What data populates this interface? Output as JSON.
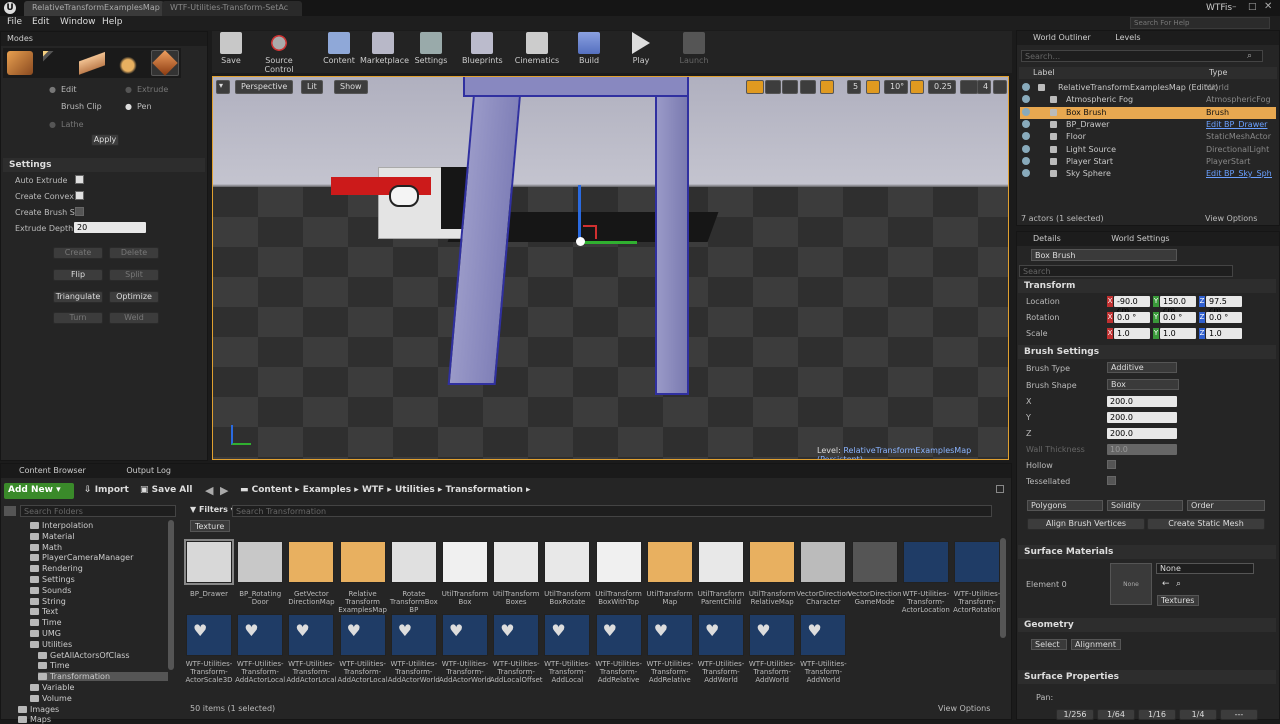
{
  "tabs": [
    {
      "label": "RelativeTransformExamplesMap"
    },
    {
      "label": "WTF-Utilities-Transform-SetAc"
    }
  ],
  "window_title": "WTFis",
  "search_help_placeholder": "Search For Help",
  "menu": [
    "File",
    "Edit",
    "Window",
    "Help"
  ],
  "modes": {
    "panel_label": "Modes",
    "edit": "Edit",
    "extrude": "Extrude",
    "brush_clip": "Brush Clip",
    "pen": "Pen",
    "lathe": "Lathe",
    "apply": "Apply",
    "settings_header": "Settings",
    "auto_extrude": "Auto Extrude",
    "create_convex": "Create Convex P",
    "create_brush": "Create Brush Sh",
    "extrude_depth": "Extrude Depth",
    "extrude_depth_value": "20",
    "buttons": {
      "create": "Create",
      "delete": "Delete",
      "flip": "Flip",
      "split": "Split",
      "triangulate": "Triangulate",
      "optimize": "Optimize",
      "turn": "Turn",
      "weld": "Weld"
    }
  },
  "toolbar": [
    {
      "label": "Save",
      "icon": "save-icon"
    },
    {
      "label": "Source Control",
      "icon": "source-control-icon"
    },
    {
      "label": "Content",
      "icon": "content-icon"
    },
    {
      "label": "Marketplace",
      "icon": "marketplace-icon"
    },
    {
      "label": "Settings",
      "icon": "settings-icon"
    },
    {
      "label": "Blueprints",
      "icon": "blueprints-icon"
    },
    {
      "label": "Cinematics",
      "icon": "cinematics-icon"
    },
    {
      "label": "Build",
      "icon": "build-icon"
    },
    {
      "label": "Play",
      "icon": "play-icon"
    },
    {
      "label": "Launch",
      "icon": "launch-icon"
    }
  ],
  "viewport": {
    "perspective": "Perspective",
    "lit": "Lit",
    "show": "Show",
    "grid_snap": "5",
    "rotation_snap": "10°",
    "scale_snap": "0.25",
    "camera_speed": "4",
    "level_label": "Level:",
    "level_name": "RelativeTransformExamplesMap (Persistent)"
  },
  "outliner": {
    "tab": "World Outliner",
    "levels_tab": "Levels",
    "search_placeholder": "Search...",
    "col_label": "Label",
    "col_type": "Type",
    "rows": [
      {
        "label": "RelativeTransformExamplesMap (Editor)",
        "type": "World"
      },
      {
        "label": "Atmospheric Fog",
        "type": "AtmosphericFog"
      },
      {
        "label": "Box Brush",
        "type": "Brush"
      },
      {
        "label": "BP_Drawer",
        "type": "Edit BP_Drawer"
      },
      {
        "label": "Floor",
        "type": "StaticMeshActor"
      },
      {
        "label": "Light Source",
        "type": "DirectionalLight"
      },
      {
        "label": "Player Start",
        "type": "PlayerStart"
      },
      {
        "label": "Sky Sphere",
        "type": "Edit BP_Sky_Sphe"
      }
    ],
    "status": "7 actors (1 selected)",
    "view_options": "View Options"
  },
  "details": {
    "tab": "Details",
    "world_settings_tab": "World Settings",
    "selected_name": "Box Brush",
    "search_placeholder": "Search",
    "transform_header": "Transform",
    "location_label": "Location",
    "rotation_label": "Rotation",
    "scale_label": "Scale",
    "location": [
      "-90.0 cm",
      "150.0 cm",
      "97.5 cm"
    ],
    "rotation": [
      "0.0 °",
      "0.0 °",
      "0.0 °"
    ],
    "scale": [
      "1.0",
      "1.0",
      "1.0"
    ],
    "axis_x": "X",
    "axis_y": "Y",
    "axis_z": "Z",
    "brush_settings_header": "Brush Settings",
    "brush_type_label": "Brush Type",
    "brush_type_value": "Additive",
    "brush_shape_label": "Brush Shape",
    "brush_shape_value": "Box",
    "x_label": "X",
    "y_label": "Y",
    "z_label": "Z",
    "x_value": "200.0",
    "y_value": "200.0",
    "z_value": "200.0",
    "wall_thickness_label": "Wall Thickness",
    "wall_thickness_value": "10.0",
    "hollow_label": "Hollow",
    "tessellated_label": "Tessellated",
    "polygons": "Polygons",
    "solidity": "Solidity",
    "order": "Order",
    "align_brush": "Align Brush Vertices",
    "create_static_mesh": "Create Static Mesh",
    "surface_materials_header": "Surface Materials",
    "element0": "Element 0",
    "none_thumb": "None",
    "none_select": "None",
    "textures": "Textures",
    "geometry_header": "Geometry",
    "select": "Select",
    "alignment": "Alignment",
    "surface_props_header": "Surface Properties",
    "pan_label": "Pan:",
    "pan_values": [
      "1/256",
      "1/64",
      "1/16",
      "1/4",
      "---"
    ]
  },
  "content_browser": {
    "tab": "Content Browser",
    "output_tab": "Output Log",
    "add_new": "Add New",
    "import": "Import",
    "save_all": "Save All",
    "breadcrumb": [
      "Content",
      "Examples",
      "WTF",
      "Utilities",
      "Transformation"
    ],
    "search_folders_placeholder": "Search Folders",
    "filters": "Filters",
    "search_placeholder": "Search Transformation",
    "filter_chip": "Texture",
    "folders": [
      "Interpolation",
      "Material",
      "Math",
      "PlayerCameraManager",
      "Rendering",
      "Settings",
      "Sounds",
      "String",
      "Text",
      "Time",
      "UMG",
      "Utilities",
      "GetAllActorsOfClass",
      "Time",
      "Transformation",
      "Variable",
      "Volume",
      "Images",
      "Maps"
    ],
    "assets_row1": [
      "BP_Drawer",
      "BP_Rotating Door",
      "GetVector DirectionMap",
      "Relative Transform ExamplesMap",
      "Rotate TransformBox BP",
      "UtilTransform Box",
      "UtilTransform Boxes",
      "UtilTransform BoxRotate",
      "UtilTransform BoxWithTop",
      "UtilTransform Map",
      "UtilTransform ParentChild",
      "UtilTransform RelativeMap",
      "VectorDirection Character",
      "VectorDirection GameMode",
      "WTF-Utilities-Transform-ActorLocation",
      "WTF-Utilities-Transform-ActorRotation"
    ],
    "assets_row2": [
      "WTF-Utilities-Transform-ActorScale3D",
      "WTF-Utilities-Transform-AddActorLocal",
      "WTF-Utilities-Transform-AddActorLocal",
      "WTF-Utilities-Transform-AddActorLocal",
      "WTF-Utilities-Transform-AddActorWorld",
      "WTF-Utilities-Transform-AddActorWorld",
      "WTF-Utilities-Transform-AddLocalOffset",
      "WTF-Utilities-Transform-AddLocal",
      "WTF-Utilities-Transform-AddRelative",
      "WTF-Utilities-Transform-AddRelative",
      "WTF-Utilities-Transform-AddWorld",
      "WTF-Utilities-Transform-AddWorld",
      "WTF-Utilities-Transform-AddWorld"
    ],
    "status": "50 items (1 selected)",
    "view_options": "View Options"
  }
}
